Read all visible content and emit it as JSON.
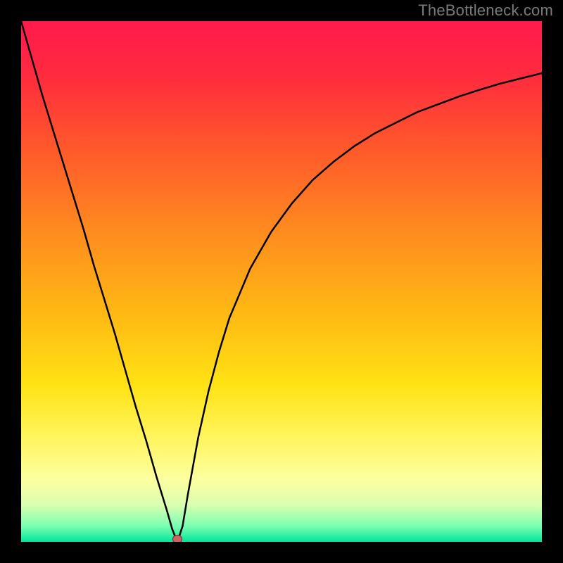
{
  "watermark": "TheBottleneck.com",
  "colors": {
    "frame": "#000000",
    "watermark": "#7a7a7a",
    "curve": "#000000",
    "marker_fill": "#d1625f",
    "marker_stroke": "#7d3a38",
    "gradient_stops": [
      {
        "offset": 0.0,
        "color": "#ff1a4d"
      },
      {
        "offset": 0.1,
        "color": "#ff2a3f"
      },
      {
        "offset": 0.25,
        "color": "#ff5a2a"
      },
      {
        "offset": 0.4,
        "color": "#ff8a1f"
      },
      {
        "offset": 0.55,
        "color": "#ffb514"
      },
      {
        "offset": 0.7,
        "color": "#ffe314"
      },
      {
        "offset": 0.8,
        "color": "#fff55e"
      },
      {
        "offset": 0.88,
        "color": "#fdffa0"
      },
      {
        "offset": 0.93,
        "color": "#d8ffb0"
      },
      {
        "offset": 0.97,
        "color": "#7affb0"
      },
      {
        "offset": 1.0,
        "color": "#00e59a"
      }
    ]
  },
  "chart_data": {
    "type": "line",
    "title": "",
    "xlabel": "",
    "ylabel": "",
    "xlim": [
      0,
      100
    ],
    "ylim": [
      0,
      100
    ],
    "grid": false,
    "series": [
      {
        "name": "bottleneck-curve",
        "x": [
          0,
          2,
          4,
          6,
          8,
          10,
          12,
          14,
          16,
          18,
          20,
          22,
          24,
          26,
          28,
          29,
          30,
          31,
          32,
          34,
          36,
          38,
          40,
          44,
          48,
          52,
          56,
          60,
          64,
          68,
          72,
          76,
          80,
          84,
          88,
          92,
          96,
          100
        ],
        "y": [
          100,
          93,
          86,
          79.5,
          73,
          66.5,
          60,
          53,
          46.5,
          40,
          33,
          26,
          19.5,
          12.5,
          6,
          2.5,
          0,
          3,
          9,
          20,
          29,
          36.5,
          43,
          52.5,
          59.5,
          65,
          69.5,
          73,
          76,
          78.5,
          80.5,
          82.5,
          84,
          85.5,
          86.8,
          88,
          89,
          90
        ]
      }
    ],
    "annotations": [
      {
        "name": "min-marker",
        "x": 30,
        "y": 0
      }
    ]
  }
}
